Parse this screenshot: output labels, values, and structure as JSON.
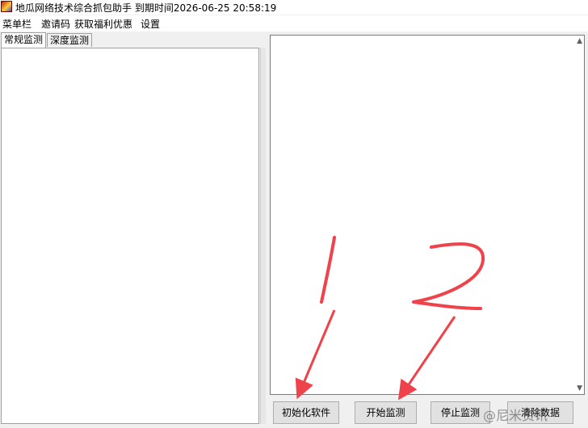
{
  "window": {
    "title": "地瓜网络技术综合抓包助手   到期时间2026-06-25 20:58:19"
  },
  "menu": {
    "items": [
      "菜单栏",
      "邀请码",
      "获取福利优惠",
      "设置"
    ]
  },
  "tabs": [
    "常规监测",
    "深度监测"
  ],
  "buttons": {
    "init": "初始化软件",
    "start": "开始监测",
    "stop": "停止监测",
    "clear": "清除数据"
  },
  "annotations": {
    "label_1": "1",
    "label_2": "2",
    "color": "#f0424a"
  },
  "watermark": "@尼米资讯"
}
